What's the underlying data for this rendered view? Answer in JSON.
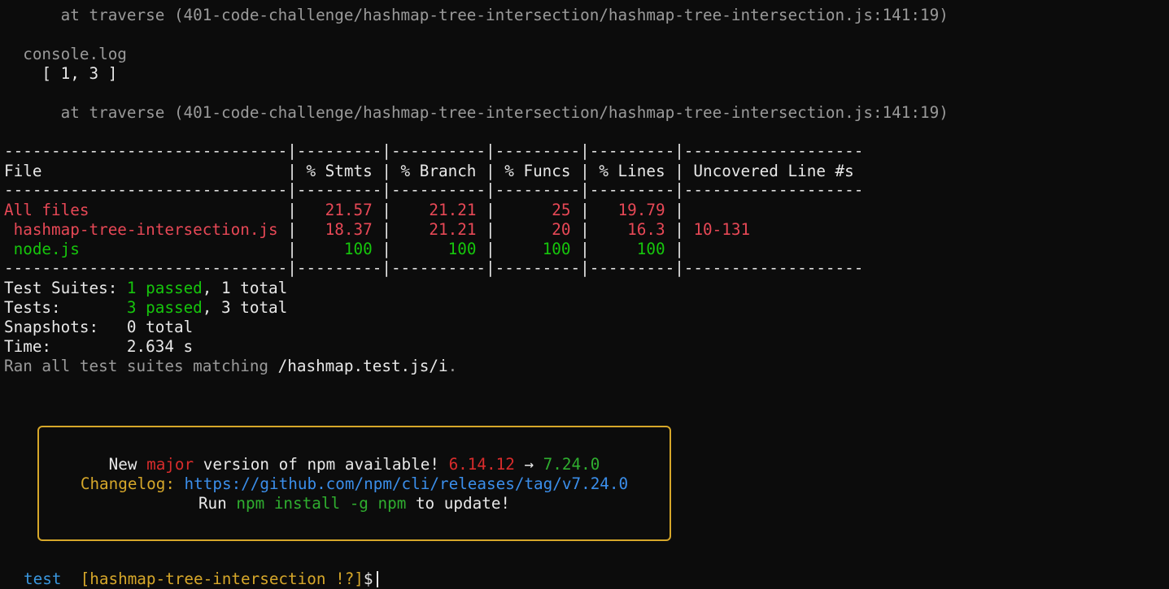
{
  "log": {
    "trace1": "      at traverse (401-code-challenge/hashmap-tree-intersection/hashmap-tree-intersection.js:141:19)",
    "console_label": "  console.log",
    "console_value": "    [ 1, 3 ]",
    "trace2": "      at traverse (401-code-challenge/hashmap-tree-intersection/hashmap-tree-intersection.js:141:19)"
  },
  "coverage": {
    "divider": "------------------------------|---------|----------|---------|---------|-------------------",
    "header": "File                          | % Stmts | % Branch | % Funcs | % Lines | Uncovered Line #s ",
    "sep": "|",
    "rows": [
      {
        "file": "All files",
        "stmts": "21.57",
        "branch": "21.21",
        "funcs": "25",
        "lines": "19.79",
        "uncovered": "",
        "status": "low"
      },
      {
        "file": " hashmap-tree-intersection.js",
        "stmts": "18.37",
        "branch": "21.21",
        "funcs": "20",
        "lines": "16.3",
        "uncovered": "10-131",
        "status": "low"
      },
      {
        "file": " node.js",
        "stmts": "100",
        "branch": "100",
        "funcs": "100",
        "lines": "100",
        "uncovered": "",
        "status": "high"
      }
    ]
  },
  "summary": {
    "suites_label": "Test Suites: ",
    "suites_passed": "1 passed",
    "suites_total": ", 1 total",
    "tests_label": "Tests:       ",
    "tests_passed": "3 passed",
    "tests_total": ", 3 total",
    "snapshots": "Snapshots:   0 total",
    "time": "Time:        2.634 s",
    "ran_prefix": "Ran all test suites matching ",
    "ran_pattern": "/hashmap.test.js/i",
    "ran_suffix": "."
  },
  "npm_notice": {
    "line1_pre": "New ",
    "line1_major": "major",
    "line1_mid": " version of npm available! ",
    "old_version": "6.14.12",
    "arrow": " → ",
    "new_version": "7.24.0",
    "changelog_label": "Changelog: ",
    "changelog_url": "https://github.com/npm/cli/releases/tag/v7.24.0",
    "run_pre": "Run ",
    "run_cmd": "npm install -g npm",
    "run_post": " to update!"
  },
  "prompt": {
    "dir": "test",
    "branch": "[hashmap-tree-intersection !?]",
    "symbol": "$"
  },
  "colors": {
    "background": "#0c0c0c",
    "low_coverage": "#e74856",
    "high_coverage": "#16c60c",
    "box_border": "#d6a72a"
  }
}
